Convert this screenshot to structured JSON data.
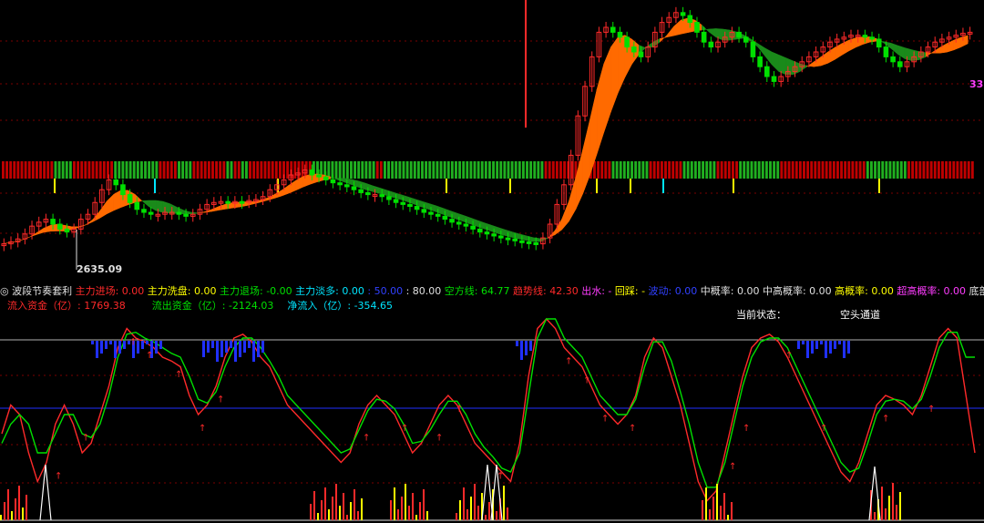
{
  "chart_data": [
    {
      "type": "line",
      "panel": "price",
      "annotations": [
        {
          "text": "2635.09",
          "note": "low price marker"
        },
        {
          "text": "33",
          "note": "right edge readout"
        }
      ],
      "price_y_values": [
        0.3,
        0.32,
        0.35,
        0.4,
        0.48,
        0.52,
        0.55,
        0.5,
        0.45,
        0.42,
        0.45,
        0.55,
        0.6,
        0.72,
        0.85,
        0.95,
        0.9,
        0.8,
        0.72,
        0.65,
        0.62,
        0.6,
        0.6,
        0.62,
        0.62,
        0.6,
        0.58,
        0.6,
        0.65,
        0.7,
        0.72,
        0.73,
        0.72,
        0.73,
        0.72,
        0.74,
        0.75,
        0.78,
        0.85,
        0.9,
        0.95,
        1.0,
        1.02,
        1.05,
        1.0,
        0.98,
        0.95,
        0.92,
        0.9,
        0.88,
        0.85,
        0.82,
        0.8,
        0.8,
        0.78,
        0.75,
        0.72,
        0.7,
        0.68,
        0.65,
        0.62,
        0.6,
        0.58,
        0.55,
        0.52,
        0.5,
        0.48,
        0.45,
        0.42,
        0.4,
        0.38,
        0.36,
        0.35,
        0.33,
        0.32,
        0.31,
        0.3,
        0.36,
        0.5,
        0.7,
        0.9,
        1.2,
        1.6,
        1.9,
        2.2,
        2.45,
        2.5,
        2.45,
        2.4,
        2.3,
        2.25,
        2.2,
        2.3,
        2.45,
        2.55,
        2.6,
        2.65,
        2.62,
        2.55,
        2.45,
        2.35,
        2.3,
        2.35,
        2.4,
        2.45,
        2.4,
        2.35,
        2.2,
        2.1,
        2.0,
        1.95,
        2.0,
        2.05,
        2.1,
        2.15,
        2.2,
        2.25,
        2.3,
        2.35,
        2.38,
        2.4,
        2.42,
        2.42,
        2.4,
        2.38,
        2.3,
        2.2,
        2.15,
        2.1,
        2.15,
        2.2,
        2.25,
        2.3,
        2.35,
        2.38,
        2.4,
        2.42,
        2.44,
        2.45
      ]
    },
    {
      "type": "line",
      "panel": "oscillator",
      "series": [
        {
          "color": "#ff2a2a",
          "values": [
            0.4,
            0.55,
            0.5,
            0.3,
            0.15,
            0.25,
            0.45,
            0.55,
            0.45,
            0.3,
            0.35,
            0.5,
            0.65,
            0.85,
            0.95,
            0.9,
            0.88,
            0.85,
            0.8,
            0.78,
            0.75,
            0.6,
            0.5,
            0.55,
            0.65,
            0.8,
            0.9,
            0.92,
            0.88,
            0.8,
            0.75,
            0.65,
            0.55,
            0.5,
            0.45,
            0.4,
            0.35,
            0.3,
            0.25,
            0.3,
            0.45,
            0.55,
            0.6,
            0.55,
            0.5,
            0.4,
            0.3,
            0.35,
            0.45,
            0.55,
            0.6,
            0.55,
            0.45,
            0.35,
            0.3,
            0.25,
            0.2,
            0.15,
            0.35,
            0.7,
            0.95,
            1.0,
            0.95,
            0.85,
            0.8,
            0.75,
            0.65,
            0.55,
            0.5,
            0.45,
            0.5,
            0.6,
            0.8,
            0.9,
            0.85,
            0.7,
            0.55,
            0.35,
            0.15,
            0.05,
            0.1,
            0.3,
            0.5,
            0.7,
            0.85,
            0.9,
            0.92,
            0.88,
            0.8,
            0.7,
            0.6,
            0.5,
            0.4,
            0.3,
            0.2,
            0.15,
            0.25,
            0.4,
            0.55,
            0.6,
            0.58,
            0.55,
            0.5,
            0.6,
            0.75,
            0.9,
            0.95,
            0.9,
            0.6,
            0.3
          ]
        },
        {
          "color": "#00e000",
          "values": [
            0.35,
            0.45,
            0.5,
            0.45,
            0.3,
            0.3,
            0.4,
            0.5,
            0.5,
            0.4,
            0.38,
            0.45,
            0.6,
            0.8,
            0.92,
            0.93,
            0.9,
            0.88,
            0.85,
            0.82,
            0.8,
            0.7,
            0.58,
            0.56,
            0.62,
            0.75,
            0.85,
            0.9,
            0.9,
            0.85,
            0.78,
            0.7,
            0.6,
            0.55,
            0.5,
            0.45,
            0.4,
            0.35,
            0.3,
            0.32,
            0.42,
            0.52,
            0.58,
            0.57,
            0.53,
            0.45,
            0.35,
            0.36,
            0.42,
            0.5,
            0.57,
            0.57,
            0.5,
            0.4,
            0.33,
            0.28,
            0.22,
            0.2,
            0.3,
            0.6,
            0.9,
            1.0,
            1.0,
            0.9,
            0.85,
            0.8,
            0.7,
            0.6,
            0.55,
            0.5,
            0.5,
            0.58,
            0.75,
            0.88,
            0.88,
            0.78,
            0.62,
            0.45,
            0.25,
            0.12,
            0.12,
            0.25,
            0.45,
            0.65,
            0.8,
            0.88,
            0.9,
            0.9,
            0.85,
            0.75,
            0.65,
            0.55,
            0.45,
            0.35,
            0.25,
            0.2,
            0.22,
            0.35,
            0.5,
            0.57,
            0.58,
            0.57,
            0.53,
            0.58,
            0.7,
            0.85,
            0.93,
            0.93,
            0.8,
            0.8
          ]
        }
      ]
    }
  ],
  "indicator_row": [
    {
      "text": "◎ 波段节奏套利",
      "color": "#e0e0e0"
    },
    {
      "text": " 主力进场: 0.00",
      "color": "#ff2a2a"
    },
    {
      "text": " 主力洗盘: 0.00",
      "color": "#ffff00"
    },
    {
      "text": " 主力退场: -0.00",
      "color": "#00e000"
    },
    {
      "text": " 主力淡多: 0.00",
      "color": "#00e5ff"
    },
    {
      "text": " : 50.00",
      "color": "#3040ff"
    },
    {
      "text": " : 80.00",
      "color": "#e0e0e0"
    },
    {
      "text": " 空方线: 64.77",
      "color": "#00e000"
    },
    {
      "text": " 趋势线: 42.30",
      "color": "#ff2a2a"
    },
    {
      "text": " 出水: -",
      "color": "#ff3cff"
    },
    {
      "text": " 回踩: -",
      "color": "#ffff00"
    },
    {
      "text": " 波动: 0.00",
      "color": "#3040ff"
    },
    {
      "text": " 中概率: 0.00",
      "color": "#e0e0e0"
    },
    {
      "text": " 中高概率: 0.00",
      "color": "#e0e0e0"
    },
    {
      "text": " 高概率: 0.00",
      "color": "#ffff00"
    },
    {
      "text": " 超高概率: 0.00",
      "color": "#ff3cff"
    },
    {
      "text": " 底部雷达:",
      "color": "#e0e0e0"
    }
  ],
  "flow_row": {
    "inflow": "流入资金（亿）: 1769.38",
    "outflow": "流出资金（亿）: -2124.03",
    "net": "净流入（亿）: -354.65",
    "inflow_color": "#ff2a2a",
    "outflow_color": "#00e000",
    "net_color": "#00e5ff"
  },
  "status": {
    "label": "当前状态：",
    "value": "空头通道"
  },
  "colors": {
    "up": "#ff2a2a",
    "down": "#00e000",
    "ribbon_up": "#ff6a00",
    "ribbon_down": "#1a8a1a",
    "grid": "#7a0000",
    "guide": "#2030ff"
  }
}
